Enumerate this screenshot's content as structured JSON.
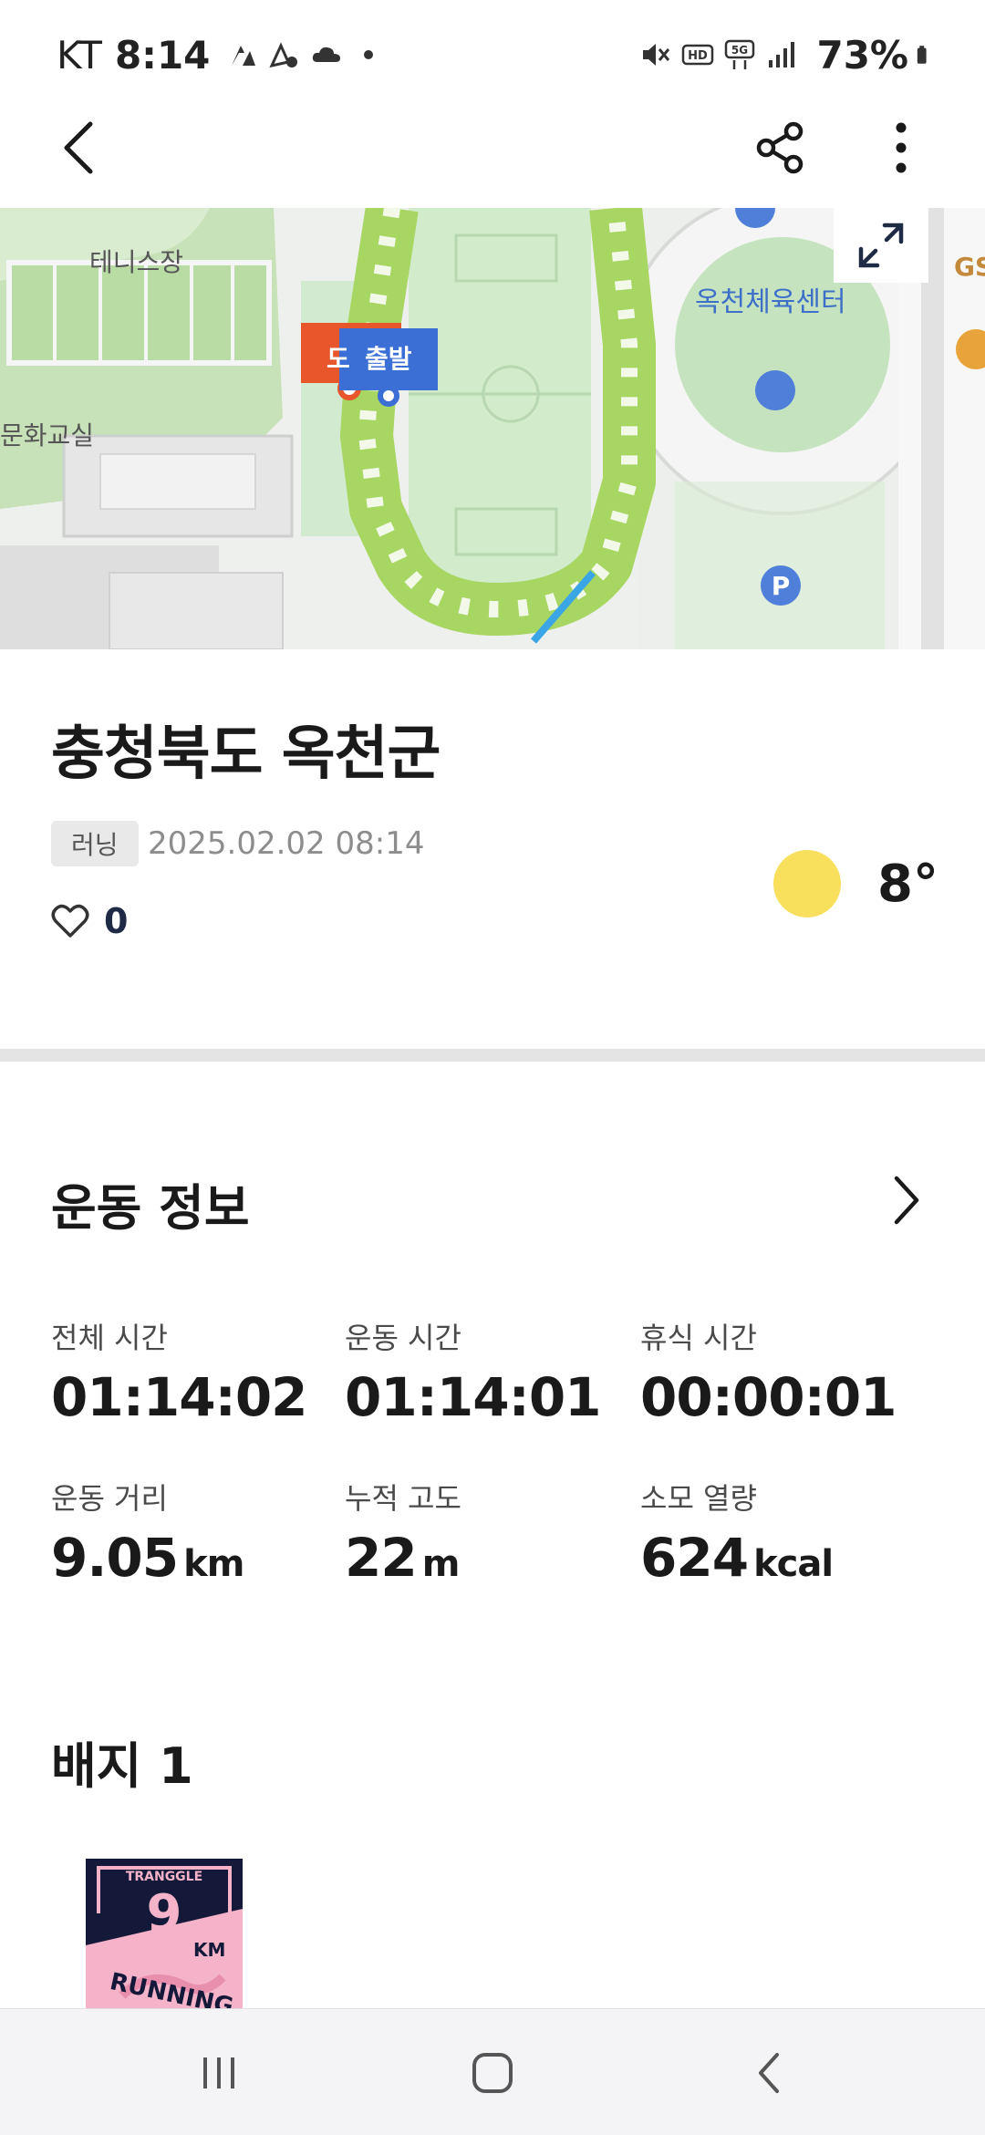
{
  "status_bar": {
    "carrier": "KT",
    "time": "8:14",
    "battery": "73%",
    "left_icons": [
      "strava-icon",
      "app-notification-icon",
      "cloud-icon",
      "dot-icon"
    ],
    "right_icons": [
      "mute-icon",
      "hd-icon",
      "5g-icon",
      "signal-icon",
      "battery-icon"
    ]
  },
  "app_bar": {
    "icons": [
      "back-arrow-icon",
      "share-icon",
      "more-vertical-icon"
    ]
  },
  "map": {
    "labels": {
      "tennis": "테니스장",
      "center": "옥천체육센터",
      "culture": "문화교실",
      "gs": "GS",
      "start": "출발",
      "finish": "도"
    },
    "expand_icon": "expand-icon",
    "colors": {
      "route": "#a8d663",
      "start": "#3b6fd6",
      "finish": "#e8572c"
    }
  },
  "activity": {
    "title": "충청북도 옥천군",
    "type": "러닝",
    "datetime": "2025.02.02 08:14",
    "likes": "0",
    "temperature": "8°",
    "weather_icon": "sun-icon"
  },
  "workout": {
    "title": "운동 정보",
    "stats": [
      {
        "label": "전체 시간",
        "value": "01:14:02",
        "unit": ""
      },
      {
        "label": "운동 시간",
        "value": "01:14:01",
        "unit": ""
      },
      {
        "label": "휴식 시간",
        "value": "00:00:01",
        "unit": ""
      },
      {
        "label": "운동 거리",
        "value": "9.05",
        "unit": "km"
      },
      {
        "label": "누적 고도",
        "value": "22",
        "unit": "m"
      },
      {
        "label": "소모 열량",
        "value": "624",
        "unit": "kcal"
      }
    ]
  },
  "badges": {
    "title": "배지 1",
    "items": [
      {
        "brand": "TRANGGLE",
        "distance": "9",
        "unit": "KM",
        "text": "RUNNING"
      }
    ]
  },
  "nav_bar": {
    "icons": [
      "recent-apps-icon",
      "home-icon",
      "back-icon"
    ]
  }
}
